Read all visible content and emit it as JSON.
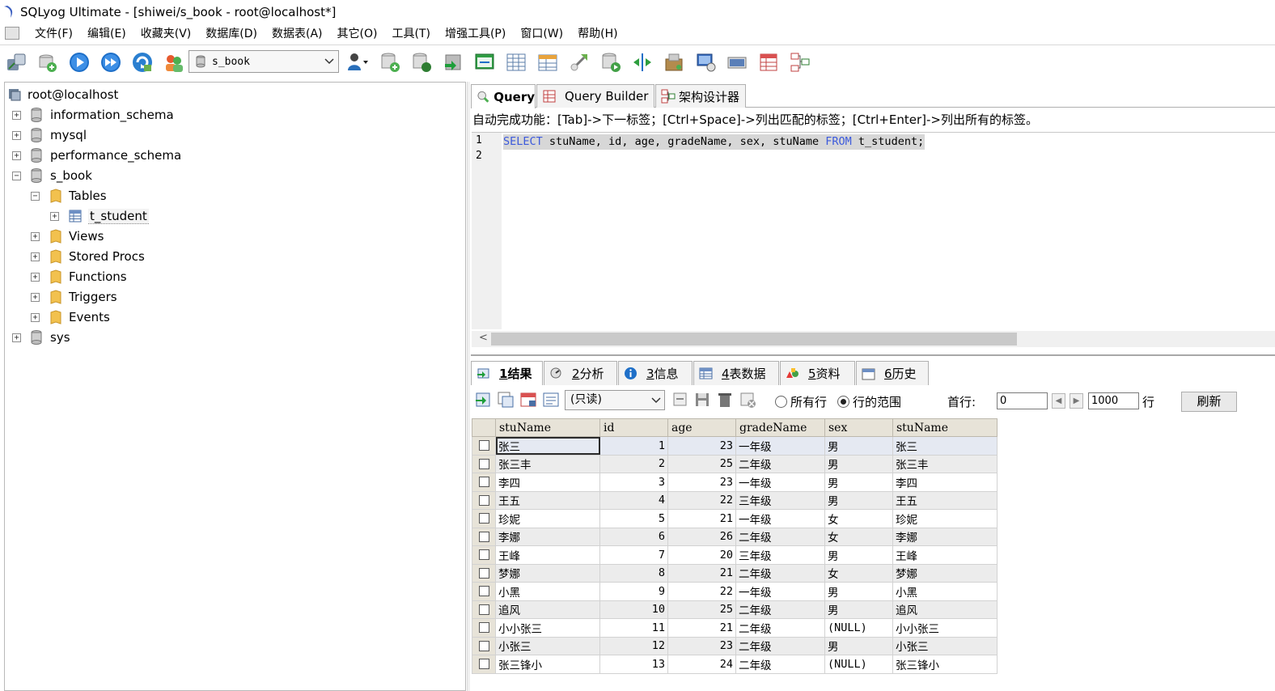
{
  "window": {
    "title": "SQLyog Ultimate - [shiwei/s_book - root@localhost*]"
  },
  "menu": [
    "文件(F)",
    "编辑(E)",
    "收藏夹(V)",
    "数据库(D)",
    "数据表(A)",
    "其它(O)",
    "工具(T)",
    "增强工具(P)",
    "窗口(W)",
    "帮助(H)"
  ],
  "toolbar": {
    "database_select": "s_book"
  },
  "tree": {
    "root": "root@localhost",
    "databases": [
      "information_schema",
      "mysql",
      "performance_schema",
      "s_book",
      "sys"
    ],
    "s_book_children": [
      "Tables",
      "Views",
      "Stored Procs",
      "Functions",
      "Triggers",
      "Events"
    ],
    "tables": [
      "t_student"
    ]
  },
  "editor": {
    "tabs": [
      "Query",
      "Query Builder",
      "架构设计器"
    ],
    "hint": "自动完成功能：[Tab]->下一标签；[Ctrl+Space]->列出匹配的标签；[Ctrl+Enter]->列出所有的标签。",
    "line_numbers": [
      "1",
      "2"
    ],
    "sql_keyword_select": "SELECT",
    "sql_columns": " stuName, id, age, gradeName, sex, stuName ",
    "sql_keyword_from": "FROM",
    "sql_table": " t_student;"
  },
  "results": {
    "tabs": [
      {
        "num": "1",
        "label": " 结果"
      },
      {
        "num": "2",
        "label": " 分析"
      },
      {
        "num": "3",
        "label": " 信息"
      },
      {
        "num": "4",
        "label": " 表数据"
      },
      {
        "num": "5",
        "label": " 资料"
      },
      {
        "num": "6",
        "label": " 历史"
      }
    ],
    "mode_select": "(只读)",
    "radio_all": "所有行",
    "radio_range": "行的范围",
    "first_row_label": "首行:",
    "first_row_value": "0",
    "row_count_value": "1000",
    "rows_label": "行",
    "refresh_label": "刷新",
    "columns": [
      "stuName",
      "id",
      "age",
      "gradeName",
      "sex",
      "stuName"
    ],
    "rows": [
      [
        "张三",
        "1",
        "23",
        "一年级",
        "男",
        "张三"
      ],
      [
        "张三丰",
        "2",
        "25",
        "二年级",
        "男",
        "张三丰"
      ],
      [
        "李四",
        "3",
        "23",
        "一年级",
        "男",
        "李四"
      ],
      [
        "王五",
        "4",
        "22",
        "三年级",
        "男",
        "王五"
      ],
      [
        "珍妮",
        "5",
        "21",
        "一年级",
        "女",
        "珍妮"
      ],
      [
        "李娜",
        "6",
        "26",
        "二年级",
        "女",
        "李娜"
      ],
      [
        "王峰",
        "7",
        "20",
        "三年级",
        "男",
        "王峰"
      ],
      [
        "梦娜",
        "8",
        "21",
        "二年级",
        "女",
        "梦娜"
      ],
      [
        "小黑",
        "9",
        "22",
        "一年级",
        "男",
        "小黑"
      ],
      [
        "追风",
        "10",
        "25",
        "二年级",
        "男",
        "追风"
      ],
      [
        "小小张三",
        "11",
        "21",
        "二年级",
        "(NULL)",
        "小小张三"
      ],
      [
        "小张三",
        "12",
        "23",
        "二年级",
        "男",
        "小张三"
      ],
      [
        "张三锋小",
        "13",
        "24",
        "二年级",
        "(NULL)",
        "张三锋小"
      ]
    ]
  },
  "colors": {
    "keyword": "#3c5adc",
    "grid_header": "#e7e3d8",
    "accent": "#1e6fc8"
  }
}
